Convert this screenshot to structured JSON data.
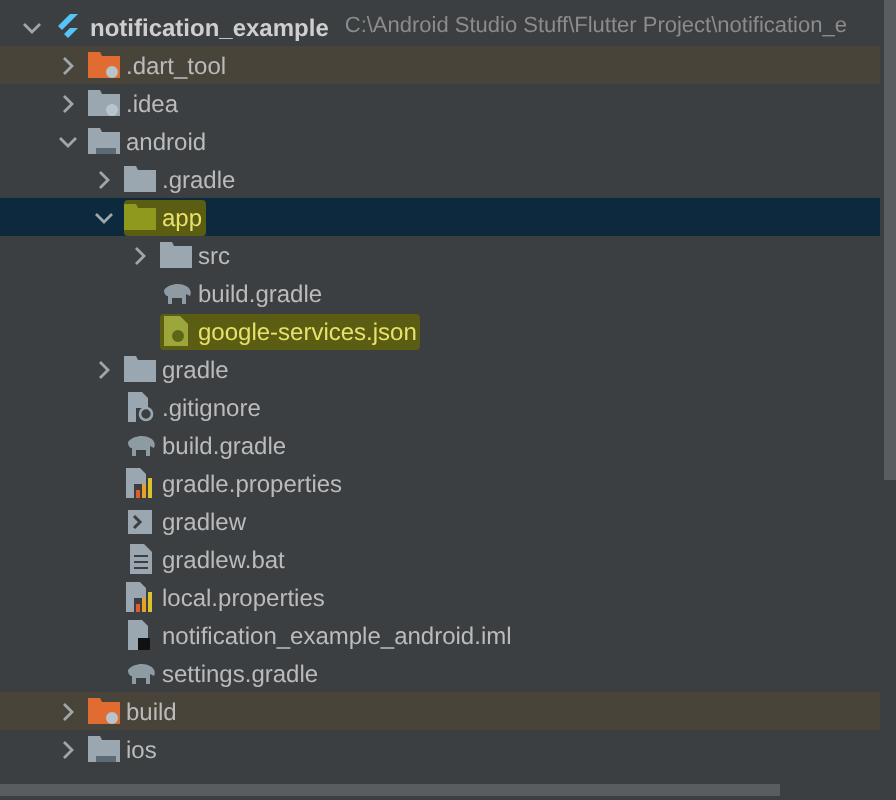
{
  "project_tree": {
    "root": {
      "name": "notification_example",
      "path": "C:\\Android Studio Stuff\\Flutter Project\\notification_e",
      "kind": "flutter",
      "expanded": true,
      "children": [
        {
          "name": ".dart_tool",
          "kind": "folder-excluded",
          "expanded": false,
          "excluded": true
        },
        {
          "name": ".idea",
          "kind": "folder-config",
          "expanded": false
        },
        {
          "name": "android",
          "kind": "folder-module",
          "expanded": true,
          "children": [
            {
              "name": ".gradle",
              "kind": "folder",
              "expanded": false
            },
            {
              "name": "app",
              "kind": "folder-source",
              "expanded": true,
              "selected": true,
              "highlighted": true,
              "children": [
                {
                  "name": "src",
                  "kind": "folder",
                  "expanded": false
                },
                {
                  "name": "build.gradle",
                  "kind": "gradle"
                },
                {
                  "name": "google-services.json",
                  "kind": "json",
                  "highlighted": true
                }
              ]
            },
            {
              "name": "gradle",
              "kind": "folder",
              "expanded": false
            },
            {
              "name": ".gitignore",
              "kind": "ignore"
            },
            {
              "name": "build.gradle",
              "kind": "gradle"
            },
            {
              "name": "gradle.properties",
              "kind": "properties"
            },
            {
              "name": "gradlew",
              "kind": "shell"
            },
            {
              "name": "gradlew.bat",
              "kind": "text"
            },
            {
              "name": "local.properties",
              "kind": "properties"
            },
            {
              "name": "notification_example_android.iml",
              "kind": "module-file"
            },
            {
              "name": "settings.gradle",
              "kind": "gradle"
            }
          ]
        },
        {
          "name": "build",
          "kind": "folder-excluded",
          "expanded": false,
          "excluded": true
        },
        {
          "name": "ios",
          "kind": "folder-module",
          "expanded": false
        }
      ]
    }
  }
}
